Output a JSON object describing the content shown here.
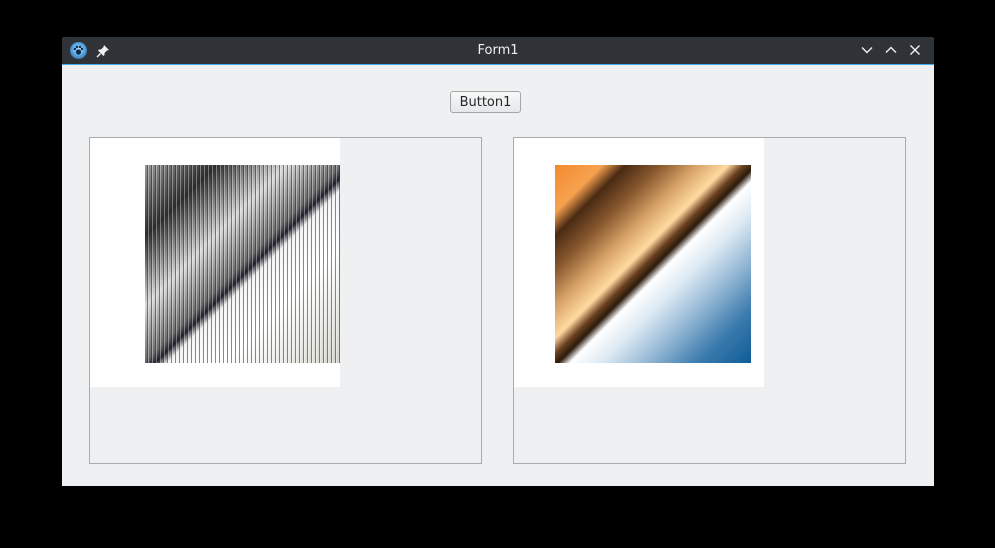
{
  "window": {
    "title": "Form1",
    "accent_color": "#3daee9",
    "titlebar_color": "#2f3337",
    "icons": [
      "app-icon",
      "pin-icon",
      "minimize-icon",
      "maximize-icon",
      "close-icon"
    ]
  },
  "form": {
    "button1_label": "Button1"
  },
  "panes": [
    {
      "name": "left-image-pane",
      "content": "striped-gradient-image"
    },
    {
      "name": "right-image-pane",
      "content": "orange-blue-gradient-image"
    }
  ]
}
